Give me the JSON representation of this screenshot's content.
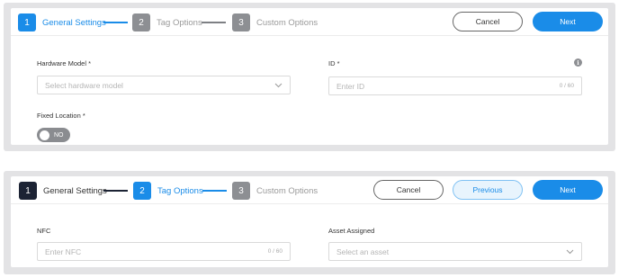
{
  "panel1": {
    "steps": [
      {
        "number": "1",
        "label": "General Settings"
      },
      {
        "number": "2",
        "label": "Tag Options"
      },
      {
        "number": "3",
        "label": "Custom Options"
      }
    ],
    "buttons": {
      "cancel": "Cancel",
      "next": "Next"
    },
    "fields": {
      "hardware_model": {
        "label": "Hardware Model *",
        "placeholder": "Select hardware model"
      },
      "id": {
        "label": "ID *",
        "placeholder": "Enter ID",
        "counter": "0 / 60"
      },
      "fixed_location": {
        "label": "Fixed Location *",
        "toggle_text": "NO"
      }
    },
    "info_glyph": "i"
  },
  "panel2": {
    "steps": [
      {
        "number": "1",
        "label": "General Settings"
      },
      {
        "number": "2",
        "label": "Tag Options"
      },
      {
        "number": "3",
        "label": "Custom Options"
      }
    ],
    "buttons": {
      "cancel": "Cancel",
      "previous": "Previous",
      "next": "Next"
    },
    "fields": {
      "nfc": {
        "label": "NFC",
        "placeholder": "Enter NFC",
        "counter": "0 / 60"
      },
      "asset_assigned": {
        "label": "Asset Assigned",
        "placeholder": "Select an asset"
      }
    }
  },
  "colors": {
    "primary": "#1a8ce8",
    "dark": "#1c2334",
    "pending": "#8d8f93",
    "panel_bg": "#e3e3e5"
  },
  "icons": {
    "dropdown": "chevron-down-icon",
    "info": "info-icon"
  }
}
